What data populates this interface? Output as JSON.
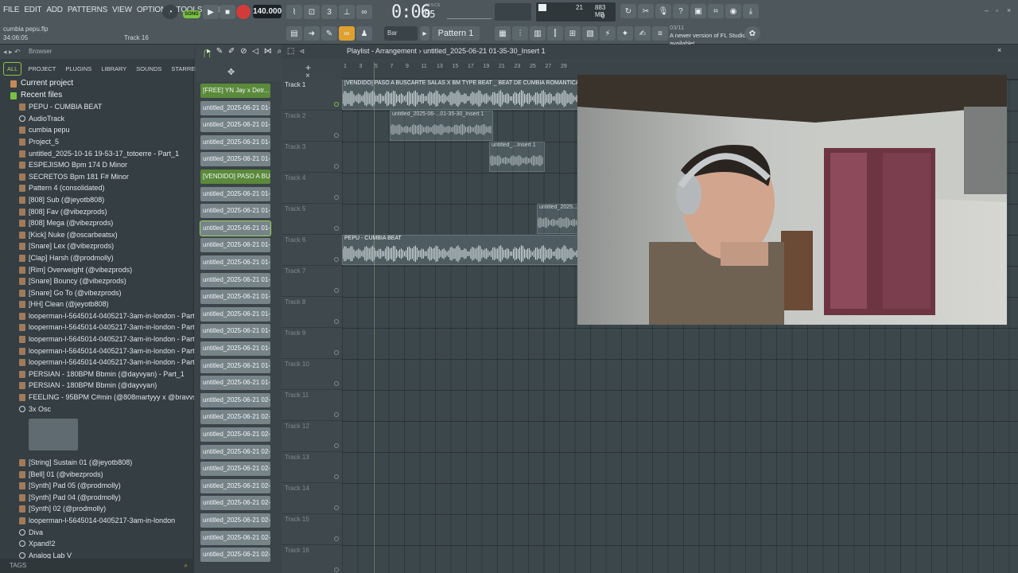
{
  "menu": [
    "FILE",
    "EDIT",
    "ADD",
    "PATTERNS",
    "VIEW",
    "OPTIONS",
    "TOOLS",
    "HELP"
  ],
  "project": {
    "file": "cumbia pepu.flp",
    "time": "34:06:05",
    "track_hint": "Track 16"
  },
  "transport": {
    "song_label": "SONG",
    "tempo": "140.000",
    "time_main": "0:06",
    "time_ms": "85",
    "time_label": "M:S:CS"
  },
  "cpu": {
    "voices": "21",
    "memory": "883 MB",
    "zero": "0"
  },
  "toolbar": {
    "snap": "Bar",
    "pattern": "Pattern 1"
  },
  "hint": {
    "num": "03/11",
    "text": "A newer version of FL Studio is available!"
  },
  "browser": {
    "title": "Browser",
    "tabs": [
      "ALL",
      "PROJECT",
      "PLUGINS",
      "LIBRARY",
      "SOUNDS",
      "STARRED"
    ],
    "items": [
      {
        "label": "Current project",
        "type": "head"
      },
      {
        "label": "Recent files",
        "type": "head-recent"
      },
      {
        "label": "PEPU - CUMBIA BEAT",
        "type": "file"
      },
      {
        "label": "AudioTrack",
        "type": "plug"
      },
      {
        "label": "cumbia pepu",
        "type": "file"
      },
      {
        "label": "Project_5",
        "type": "file"
      },
      {
        "label": "untitled_2025-10-16 19-53-17_totoerre - Part_1",
        "type": "file"
      },
      {
        "label": "ESPEJISMO Bpm 174 D Minor",
        "type": "file"
      },
      {
        "label": "SECRETOS Bpm 181 F# Minor",
        "type": "file"
      },
      {
        "label": "Pattern 4 (consolidated)",
        "type": "file"
      },
      {
        "label": "[808] Sub (@jeyotb808)",
        "type": "file"
      },
      {
        "label": "[808] Fav (@vibezprods)",
        "type": "file"
      },
      {
        "label": "[808] Mega (@vibezprods)",
        "type": "file"
      },
      {
        "label": "[Kick] Nuke (@oscarbeatsx)",
        "type": "file"
      },
      {
        "label": "[Snare] Lex (@vibezprods)",
        "type": "file"
      },
      {
        "label": "[Clap] Harsh (@prodmolly)",
        "type": "file"
      },
      {
        "label": "[Rim] Overweight (@vibezprods)",
        "type": "file"
      },
      {
        "label": "[Snare] Bouncy (@vibezprods)",
        "type": "file"
      },
      {
        "label": "[Snare] Go To (@vibezprods)",
        "type": "file"
      },
      {
        "label": "[HH] Clean (@jeyotb808)",
        "type": "file"
      },
      {
        "label": "looperman-l-5645014-0405217-3am-in-london - Part_5",
        "type": "file"
      },
      {
        "label": "looperman-l-5645014-0405217-3am-in-london - Part_4",
        "type": "file"
      },
      {
        "label": "looperman-l-5645014-0405217-3am-in-london - Part_3",
        "type": "file"
      },
      {
        "label": "looperman-l-5645014-0405217-3am-in-london - Part_2",
        "type": "file"
      },
      {
        "label": "looperman-l-5645014-0405217-3am-in-london - Part_1",
        "type": "file"
      },
      {
        "label": "PERSIAN - 180BPM Bbmin (@dayvyan)  - Part_1",
        "type": "file"
      },
      {
        "label": "PERSIAN - 180BPM Bbmin (@dayvyan)",
        "type": "file"
      },
      {
        "label": "FEELING - 95BPM C#min (@808martyyy x @bravvs)",
        "type": "file"
      },
      {
        "label": "3x Osc",
        "type": "plug"
      }
    ],
    "items_after": [
      {
        "label": "[String] Sustain 01 (@jeyotb808)",
        "type": "file"
      },
      {
        "label": "[Bell] 01 (@vibezprods)",
        "type": "file"
      },
      {
        "label": "[Synth] Pad 05 (@prodmolly)",
        "type": "file"
      },
      {
        "label": "[Synth] Pad 04 (@prodmolly)",
        "type": "file"
      },
      {
        "label": "[Synth] 02 (@prodmolly)",
        "type": "file"
      },
      {
        "label": "looperman-l-5645014-0405217-3am-in-london",
        "type": "file"
      },
      {
        "label": "Diva",
        "type": "plug"
      },
      {
        "label": "Xpand!2",
        "type": "plug"
      },
      {
        "label": "Analog Lab V",
        "type": "plug"
      }
    ],
    "tags_label": "TAGS"
  },
  "channels": [
    {
      "label": "[FREE] YN Jay x Detr...",
      "style": "green"
    },
    {
      "label": "untitled_2025-06-21 01-...",
      "style": "grey"
    },
    {
      "label": "untitled_2025-06-21 01-...",
      "style": "grey"
    },
    {
      "label": "untitled_2025-06-21 01-...",
      "style": "grey"
    },
    {
      "label": "untitled_2025-06-21 01-...",
      "style": "grey"
    },
    {
      "label": "[VENDIDO] PASO A BU...",
      "style": "green"
    },
    {
      "label": "untitled_2025-06-21 01-...",
      "style": "grey"
    },
    {
      "label": "untitled_2025-06-21 01-...",
      "style": "grey"
    },
    {
      "label": "untitled_2025-06-21 01-...",
      "style": "sel"
    },
    {
      "label": "untitled_2025-06-21 01-...",
      "style": "grey"
    },
    {
      "label": "untitled_2025-06-21 01-...",
      "style": "grey"
    },
    {
      "label": "untitled_2025-06-21 01-...",
      "style": "grey"
    },
    {
      "label": "untitled_2025-06-21 01-...",
      "style": "grey"
    },
    {
      "label": "untitled_2025-06-21 01-...",
      "style": "grey"
    },
    {
      "label": "untitled_2025-06-21 01-...",
      "style": "grey"
    },
    {
      "label": "untitled_2025-06-21 01-...",
      "style": "grey"
    },
    {
      "label": "untitled_2025-06-21 01-...",
      "style": "grey"
    },
    {
      "label": "untitled_2025-06-21 01-...",
      "style": "grey"
    },
    {
      "label": "untitled_2025-06-21 02-...",
      "style": "grey"
    },
    {
      "label": "untitled_2025-06-21 02-...",
      "style": "grey"
    },
    {
      "label": "untitled_2025-06-21 02-...",
      "style": "grey"
    },
    {
      "label": "untitled_2025-06-21 02-...",
      "style": "grey"
    },
    {
      "label": "untitled_2025-06-21 02-...",
      "style": "grey"
    },
    {
      "label": "untitled_2025-06-21 02-...",
      "style": "grey"
    },
    {
      "label": "untitled_2025-06-21 02-...",
      "style": "grey"
    },
    {
      "label": "untitled_2025-06-21 02-...",
      "style": "grey"
    },
    {
      "label": "untitled_2025-06-21 02-...",
      "style": "grey"
    },
    {
      "label": "untitled_2025-06-21 02-...",
      "style": "grey"
    }
  ],
  "playlist": {
    "title": "Playlist - Arrangement",
    "breadcrumb": "untitled_2025-06-21 01-35-30_Insert 1",
    "ruler": [
      "1",
      "3",
      "5",
      "7",
      "9",
      "11",
      "13",
      "15",
      "17",
      "19",
      "21",
      "23",
      "25",
      "27",
      "29"
    ],
    "tracks": [
      "Track 1",
      "Track 2",
      "Track 3",
      "Track 4",
      "Track 5",
      "Track 6",
      "Track 7",
      "Track 8",
      "Track 9",
      "Track 10",
      "Track 11",
      "Track 12",
      "Track 13",
      "Track 14",
      "Track 15",
      "Track 16"
    ],
    "clips": [
      {
        "label": "[VENDIDO] PASO A BUSCARTE SALAS X BM TYPE BEAT _ BEAT DE CUMBIA ROMANTICA - 3o",
        "track": 1,
        "style": "main"
      },
      {
        "label": "untitled_2025-06-...01-35-30_Insert 1",
        "track": 2,
        "style": "dim"
      },
      {
        "label": "untitled_...Insert 1",
        "track": 3,
        "style": "dim"
      },
      {
        "label": "untitled_2025...",
        "track": 5,
        "style": "dim"
      },
      {
        "label": "PEPU - CUMBIA BEAT",
        "track": 6,
        "style": "main"
      }
    ]
  },
  "colors": {
    "accent_green": "#7ac043",
    "record_red": "#d33b3b"
  }
}
